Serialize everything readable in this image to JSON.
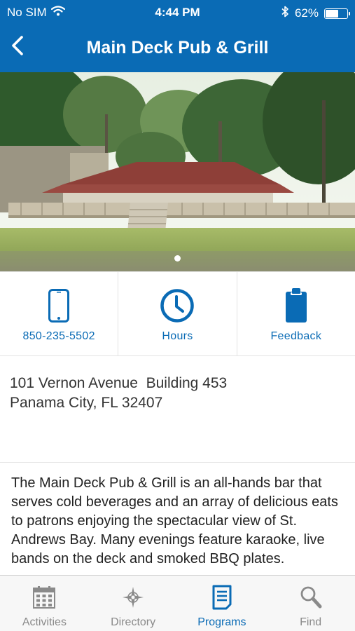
{
  "status_bar": {
    "carrier": "No SIM",
    "time": "4:44 PM",
    "battery_percent": "62%",
    "battery_level": 0.62,
    "icons": [
      "wifi-icon",
      "bluetooth-icon",
      "battery-icon"
    ]
  },
  "nav": {
    "title": "Main Deck Pub & Grill",
    "back_icon": "chevron-left-icon"
  },
  "hero": {
    "page_count": 1,
    "current_page": 1
  },
  "actions": [
    {
      "label": "850-235-5502",
      "icon": "phone-icon"
    },
    {
      "label": "Hours",
      "icon": "clock-icon"
    },
    {
      "label": "Feedback",
      "icon": "clipboard-icon"
    }
  ],
  "address": {
    "line1": "101 Vernon Avenue  Building 453",
    "line2": "Panama City, FL 32407"
  },
  "description": "The Main Deck Pub & Grill is an all-hands bar that serves cold beverages and an array of delicious eats to patrons enjoying the spectacular view of St. Andrews Bay. Many evenings feature karaoke, live bands on the deck and smoked BBQ plates.",
  "tabbar": {
    "items": [
      {
        "label": "Activities",
        "icon": "calendar-icon",
        "active": false
      },
      {
        "label": "Directory",
        "icon": "compass-icon",
        "active": false
      },
      {
        "label": "Programs",
        "icon": "document-icon",
        "active": true
      },
      {
        "label": "Find",
        "icon": "search-icon",
        "active": false
      }
    ]
  },
  "colors": {
    "brand_blue": "#0a6bb5",
    "tab_inactive": "#8a8a8a",
    "text": "#333333"
  }
}
